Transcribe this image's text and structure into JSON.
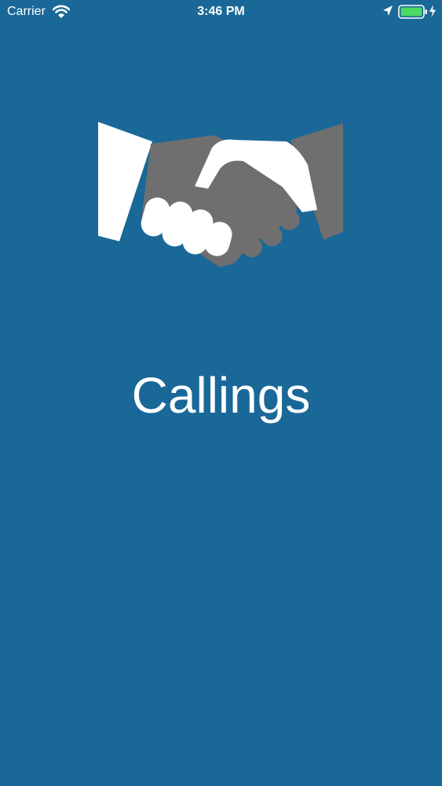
{
  "status_bar": {
    "carrier": "Carrier",
    "time": "3:46 PM",
    "battery_color": "#4cd964",
    "icons": [
      "wifi-icon",
      "location-arrow-icon",
      "battery-icon",
      "charging-bolt-icon"
    ]
  },
  "splash": {
    "logo_icon": "handshake-icon",
    "app_name": "Callings",
    "background_color": "#1a6898"
  }
}
